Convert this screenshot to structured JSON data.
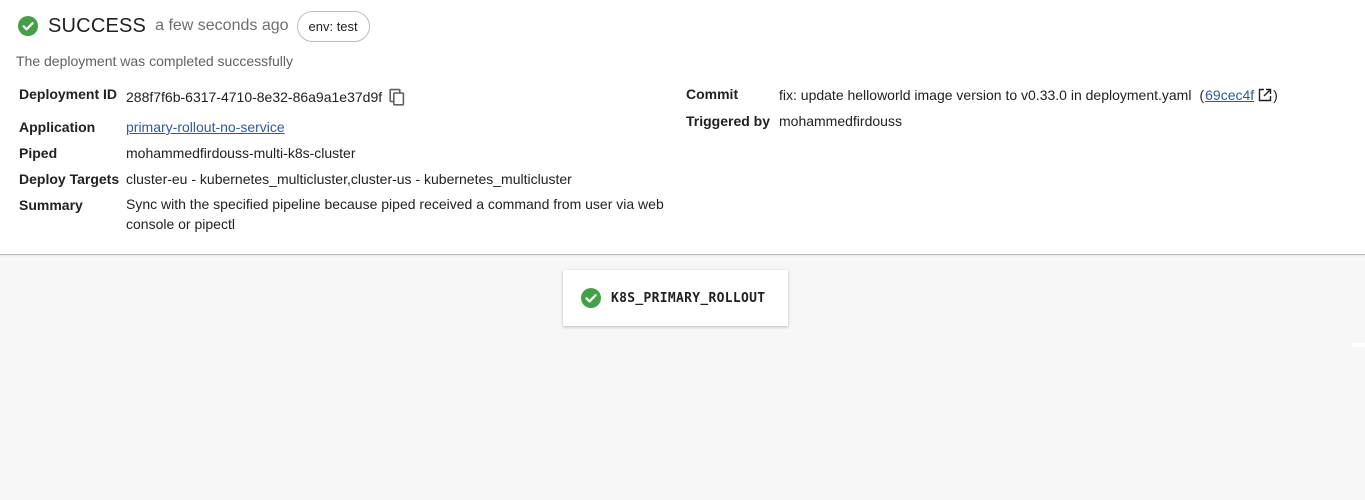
{
  "header": {
    "status": "SUCCESS",
    "time": "a few seconds ago",
    "env_chip": "env: test",
    "description": "The deployment was completed successfully"
  },
  "details": {
    "deployment_id": {
      "label": "Deployment ID",
      "value": "288f7f6b-6317-4710-8e32-86a9a1e37d9f"
    },
    "application": {
      "label": "Application",
      "value": "primary-rollout-no-service"
    },
    "piped": {
      "label": "Piped",
      "value": "mohammedfirdouss-multi-k8s-cluster"
    },
    "deploy_targets": {
      "label": "Deploy Targets",
      "value": "cluster-eu - kubernetes_multicluster,cluster-us - kubernetes_multicluster"
    },
    "summary": {
      "label": "Summary",
      "value_line1": "Sync with the specified pipeline because piped received a command from user via web",
      "value_line2": "console or pipectl"
    },
    "commit": {
      "label": "Commit",
      "message": "fix: update helloworld image version to v0.33.0 in deployment.yaml",
      "open_paren": "(",
      "hash": "69cec4f",
      "close_paren": ")"
    },
    "triggered_by": {
      "label": "Triggered by",
      "value": "mohammedfirdouss"
    }
  },
  "pipeline": {
    "stages": [
      {
        "name": "K8S_PRIMARY_ROLLOUT",
        "status": "success"
      }
    ]
  },
  "icons": {
    "status": "check-circle-icon",
    "copy": "copy-icon",
    "external": "open-in-new-icon"
  },
  "colors": {
    "success": "#43a047",
    "link": "#2c5aa0"
  }
}
